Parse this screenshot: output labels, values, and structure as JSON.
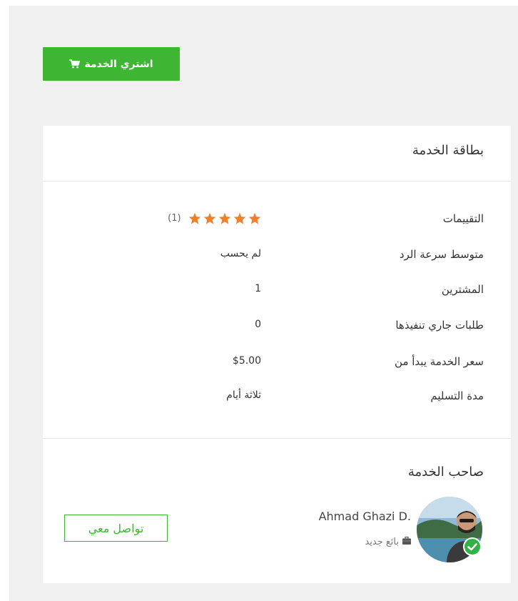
{
  "buy_button": {
    "label": "اشتري الخدمة",
    "icon": "shopping-cart-icon"
  },
  "card": {
    "title": "بطاقة الخدمة",
    "rows": [
      {
        "label": "التقييمات",
        "stars": 5,
        "rating_count": "(1)"
      },
      {
        "label": "متوسط سرعة الرد",
        "value": "لم يحسب"
      },
      {
        "label": "المشترين",
        "value": "1"
      },
      {
        "label": "طلبات جاري تنفيذها",
        "value": "0"
      },
      {
        "label": "سعر الخدمة يبدأ من",
        "value": "$5.00"
      },
      {
        "label": "مدة التسليم",
        "value": "ثلاثة أيام"
      }
    ]
  },
  "owner": {
    "title": "صاحب الخدمة",
    "name": "Ahmad Ghazi D.",
    "level": "بائع جديد",
    "level_icon": "briefcase-icon",
    "verified_icon": "verified-check-icon",
    "contact_label": "تواصل معي"
  },
  "colors": {
    "accent": "#3eb533",
    "star": "#f07f2b",
    "verified": "#2fb344",
    "background": "#f0f0f0"
  }
}
